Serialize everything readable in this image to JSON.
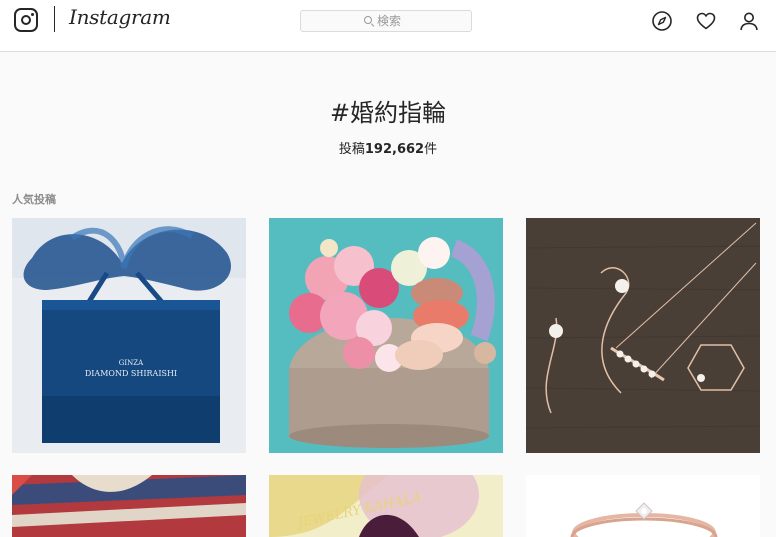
{
  "header": {
    "wordmark": "Instagram",
    "search_placeholder": "検索",
    "icons": [
      "instagram-logo-icon",
      "search-icon",
      "explore-compass-icon",
      "activity-heart-icon",
      "profile-icon"
    ]
  },
  "hashtag": {
    "title": "#婚約指輪",
    "count_prefix": "投稿",
    "count": "192,662",
    "count_suffix": "件"
  },
  "top_posts": {
    "label": "人気投稿",
    "tiles": [
      {
        "box_text_line1": "GINZA",
        "box_text_line2": "DIAMOND SHIRAISHI"
      },
      {},
      {},
      {},
      {
        "overlay_text": "JEWELRY KAHALA"
      },
      {}
    ]
  },
  "colors": {
    "border": "#dbdbdb",
    "text": "#262626",
    "muted": "#8e8e8e",
    "background": "#fafafa"
  }
}
